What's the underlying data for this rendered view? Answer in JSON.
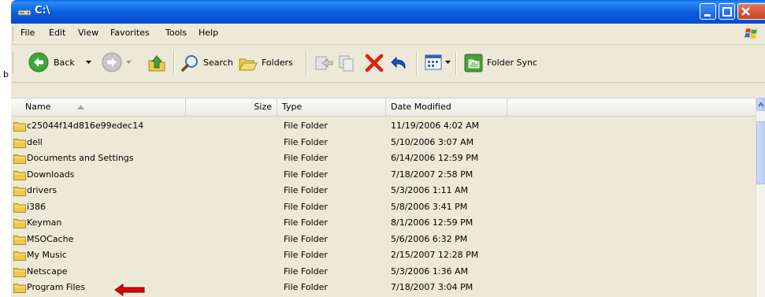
{
  "window": {
    "title": "C:\\",
    "edge_letter": "b"
  },
  "menu": {
    "items": [
      "File",
      "Edit",
      "View",
      "Favorites",
      "Tools",
      "Help"
    ]
  },
  "toolbar": {
    "back_label": "Back",
    "search_label": "Search",
    "folders_label": "Folders",
    "folder_sync_label": "Folder Sync"
  },
  "columns": {
    "name": "Name",
    "size": "Size",
    "type": "Type",
    "date": "Date Modified"
  },
  "files": [
    {
      "name": "c25044f14d816e99edec14",
      "type": "File Folder",
      "date": "11/19/2006 4:02 AM"
    },
    {
      "name": "dell",
      "type": "File Folder",
      "date": "5/10/2006 3:07 AM"
    },
    {
      "name": "Documents and Settings",
      "type": "File Folder",
      "date": "6/14/2006 12:59 PM"
    },
    {
      "name": "Downloads",
      "type": "File Folder",
      "date": "7/18/2007 2:58 PM"
    },
    {
      "name": "drivers",
      "type": "File Folder",
      "date": "5/3/2006 1:11 AM"
    },
    {
      "name": "i386",
      "type": "File Folder",
      "date": "5/8/2006 3:41 PM"
    },
    {
      "name": "Keyman",
      "type": "File Folder",
      "date": "8/1/2006 12:59 PM"
    },
    {
      "name": "MSOCache",
      "type": "File Folder",
      "date": "5/6/2006 6:32 PM"
    },
    {
      "name": "My Music",
      "type": "File Folder",
      "date": "2/15/2007 12:28 PM"
    },
    {
      "name": "Netscape",
      "type": "File Folder",
      "date": "5/3/2006 1:36 AM"
    },
    {
      "name": "Program Files",
      "type": "File Folder",
      "date": "7/18/2007 3:04 PM"
    }
  ],
  "colors": {
    "titlebar": "#0552d4",
    "chrome": "#ece9d8",
    "folder": "#f2c84b",
    "annotation_arrow": "#e00000"
  },
  "icons": {
    "title": "drive-icon",
    "back": "back-arrow-icon",
    "forward": "forward-arrow-icon",
    "up": "up-folder-icon",
    "search": "search-icon",
    "folders": "folders-icon",
    "move_to": "move-to-icon",
    "copy_to": "copy-to-icon",
    "delete": "delete-icon",
    "undo": "undo-icon",
    "views": "views-icon",
    "folder_sync": "folder-sync-icon"
  }
}
